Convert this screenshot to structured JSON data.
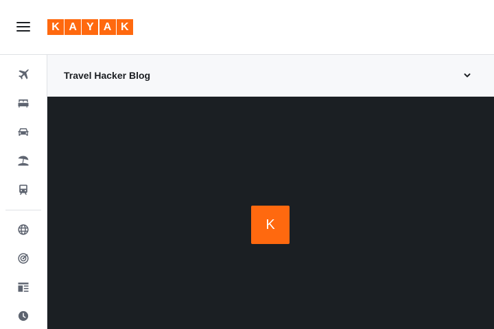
{
  "header": {
    "menu_icon": "hamburger-menu-icon",
    "logo_letters": [
      "K",
      "A",
      "Y",
      "A",
      "K"
    ],
    "brand_color": "#ff690f"
  },
  "sidebar": {
    "items": [
      {
        "icon": "flight-icon",
        "label": "Flights"
      },
      {
        "icon": "hotel-bed-icon",
        "label": "Stays"
      },
      {
        "icon": "car-icon",
        "label": "Cars"
      },
      {
        "icon": "beach-umbrella-icon",
        "label": "Packages"
      },
      {
        "icon": "train-icon",
        "label": "Trains"
      },
      {
        "icon": "globe-icon",
        "label": "Explore"
      },
      {
        "icon": "target-icon",
        "label": "Trips"
      },
      {
        "icon": "blog-icon",
        "label": "Travel Hacker Blog"
      },
      {
        "icon": "clock-icon",
        "label": "Recent"
      }
    ],
    "icon_color": "#5e6470"
  },
  "subheader": {
    "title": "Travel Hacker Blog",
    "chevron_icon": "chevron-down-icon"
  },
  "main": {
    "background": "#1b1f23",
    "loader_letter": "K"
  }
}
